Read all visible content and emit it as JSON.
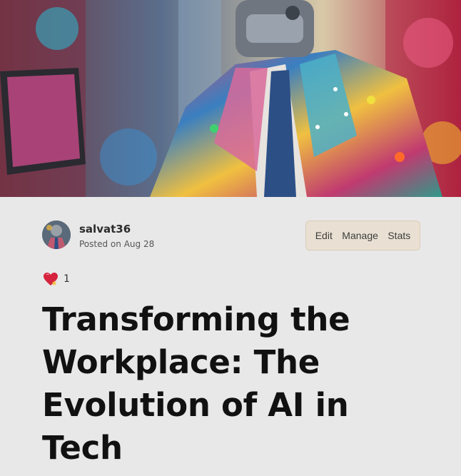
{
  "cover": {
    "icon": "robot-businessman-cover-image"
  },
  "author": {
    "name": "salvat36",
    "avatar_icon": "avatar-icon"
  },
  "post": {
    "posted_prefix": "Posted on",
    "date": "Aug 28"
  },
  "actions": {
    "edit": "Edit",
    "manage": "Manage",
    "stats": "Stats"
  },
  "reactions": {
    "icon": "sparkle-heart-icon",
    "count": "1"
  },
  "article": {
    "title": "Transforming the Workplace: The Evolution of AI in Tech"
  },
  "colors": {
    "background": "#e8e8e8",
    "actions_bg": "#e9e0d3",
    "title": "#111111"
  }
}
